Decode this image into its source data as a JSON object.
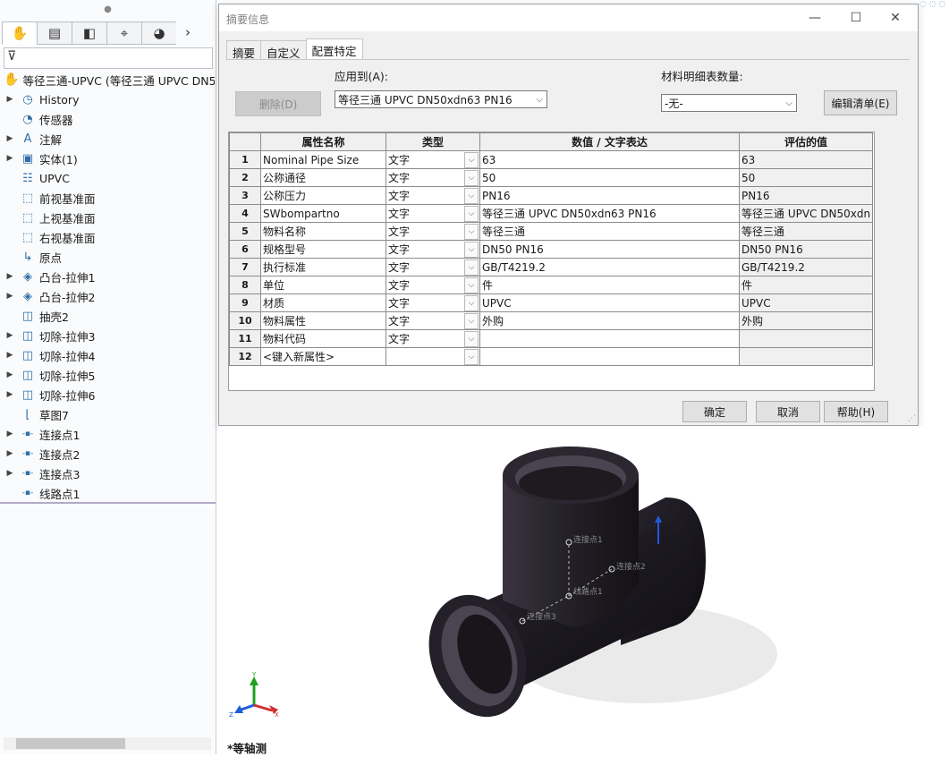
{
  "feature_tree": {
    "tabs": [
      {
        "name": "feature-manager",
        "glyph": "✋",
        "active": true
      },
      {
        "name": "property-manager",
        "glyph": "▤",
        "active": false
      },
      {
        "name": "configuration-manager",
        "glyph": "◧",
        "active": false
      },
      {
        "name": "dimxpert-manager",
        "glyph": "⌖",
        "active": false
      },
      {
        "name": "display-manager",
        "glyph": "◕",
        "active": false
      }
    ],
    "tabs_more": "›",
    "root_label": "等径三通-UPVC  (等径三通 UPVC DN50",
    "items": [
      {
        "label": "History",
        "expand": true,
        "icon": "history-icon",
        "glyph": "◷"
      },
      {
        "label": "传感器",
        "expand": false,
        "icon": "sensor-icon",
        "glyph": "◔"
      },
      {
        "label": "注解",
        "expand": true,
        "icon": "annotation-icon",
        "glyph": "A"
      },
      {
        "label": "实体(1)",
        "expand": true,
        "icon": "solid-body-icon",
        "glyph": "▣"
      },
      {
        "label": "UPVC",
        "expand": false,
        "icon": "material-icon",
        "glyph": "☷"
      },
      {
        "label": "前视基准面",
        "expand": false,
        "icon": "plane-icon",
        "glyph": "⬚"
      },
      {
        "label": "上视基准面",
        "expand": false,
        "icon": "plane-icon",
        "glyph": "⬚"
      },
      {
        "label": "右视基准面",
        "expand": false,
        "icon": "plane-icon",
        "glyph": "⬚"
      },
      {
        "label": "原点",
        "expand": false,
        "icon": "origin-icon",
        "glyph": "↳"
      },
      {
        "label": "凸台-拉伸1",
        "expand": true,
        "icon": "boss-extrude-icon",
        "glyph": "◈"
      },
      {
        "label": "凸台-拉伸2",
        "expand": true,
        "icon": "boss-extrude-icon",
        "glyph": "◈"
      },
      {
        "label": "抽壳2",
        "expand": false,
        "icon": "shell-icon",
        "glyph": "◫"
      },
      {
        "label": "切除-拉伸3",
        "expand": true,
        "icon": "cut-extrude-icon",
        "glyph": "◫"
      },
      {
        "label": "切除-拉伸4",
        "expand": true,
        "icon": "cut-extrude-icon",
        "glyph": "◫"
      },
      {
        "label": "切除-拉伸5",
        "expand": true,
        "icon": "cut-extrude-icon",
        "glyph": "◫"
      },
      {
        "label": "切除-拉伸6",
        "expand": true,
        "icon": "cut-extrude-icon",
        "glyph": "◫"
      },
      {
        "label": "草图7",
        "expand": false,
        "icon": "sketch-icon",
        "glyph": "⌊"
      },
      {
        "label": "连接点1",
        "expand": true,
        "icon": "connection-point-icon",
        "glyph": "-▪-"
      },
      {
        "label": "连接点2",
        "expand": true,
        "icon": "connection-point-icon",
        "glyph": "-▪-"
      },
      {
        "label": "连接点3",
        "expand": true,
        "icon": "connection-point-icon",
        "glyph": "-▪-"
      },
      {
        "label": "线路点1",
        "expand": false,
        "icon": "route-point-icon",
        "glyph": "-▪-"
      }
    ]
  },
  "dialog": {
    "title": "摘要信息",
    "window_buttons": {
      "minimize": "—",
      "maximize": "☐",
      "close": "✕"
    },
    "tabs": [
      {
        "label": "摘要",
        "active": false
      },
      {
        "label": "自定义",
        "active": false
      },
      {
        "label": "配置特定",
        "active": true
      }
    ],
    "apply_to_label": "应用到(A):",
    "apply_to_value": "等径三通 UPVC DN50xdn63 PN16",
    "bom_qty_label": "材料明细表数量:",
    "bom_qty_value": "-无-",
    "delete_button": "删除(D)",
    "edit_list_button": "编辑清单(E)",
    "table": {
      "headers": [
        "属性名称",
        "类型",
        "数值 / 文字表达",
        "评估的值"
      ],
      "rows": [
        {
          "n": "1",
          "name": "Nominal Pipe Size",
          "type": "文字",
          "value": "63",
          "evaluated": "63"
        },
        {
          "n": "2",
          "name": "公称通径",
          "type": "文字",
          "value": "50",
          "evaluated": "50"
        },
        {
          "n": "3",
          "name": "公称压力",
          "type": "文字",
          "value": "PN16",
          "evaluated": "PN16"
        },
        {
          "n": "4",
          "name": "SWbompartno",
          "type": "文字",
          "value": "等径三通 UPVC DN50xdn63 PN16",
          "evaluated": "等径三通 UPVC DN50xdn"
        },
        {
          "n": "5",
          "name": "物料名称",
          "type": "文字",
          "value": "等径三通",
          "evaluated": "等径三通"
        },
        {
          "n": "6",
          "name": "规格型号",
          "type": "文字",
          "value": "DN50 PN16",
          "evaluated": "DN50 PN16"
        },
        {
          "n": "7",
          "name": "执行标准",
          "type": "文字",
          "value": "GB/T4219.2",
          "evaluated": "GB/T4219.2"
        },
        {
          "n": "8",
          "name": "单位",
          "type": "文字",
          "value": "件",
          "evaluated": "件"
        },
        {
          "n": "9",
          "name": "材质",
          "type": "文字",
          "value": "UPVC",
          "evaluated": "UPVC"
        },
        {
          "n": "10",
          "name": "物料属性",
          "type": "文字",
          "value": "外购",
          "evaluated": "外购"
        },
        {
          "n": "11",
          "name": "物料代码",
          "type": "文字",
          "value": "",
          "evaluated": ""
        },
        {
          "n": "12",
          "name": "<键入新属性>",
          "type": "",
          "value": "",
          "evaluated": ""
        }
      ]
    },
    "ok_button": "确定",
    "cancel_button": "取消",
    "help_button": "帮助(H)"
  },
  "viewport": {
    "view_label": "*等轴测",
    "point_labels": [
      "连接点1",
      "连接点2",
      "线路点1",
      "连接点3"
    ],
    "triad": {
      "x": "X",
      "y": "Y",
      "z": "Z"
    }
  },
  "colors": {
    "pipe": "#1e1a20",
    "axis_x": "#d03030",
    "axis_y": "#20a020",
    "axis_z": "#1e5bd8"
  }
}
